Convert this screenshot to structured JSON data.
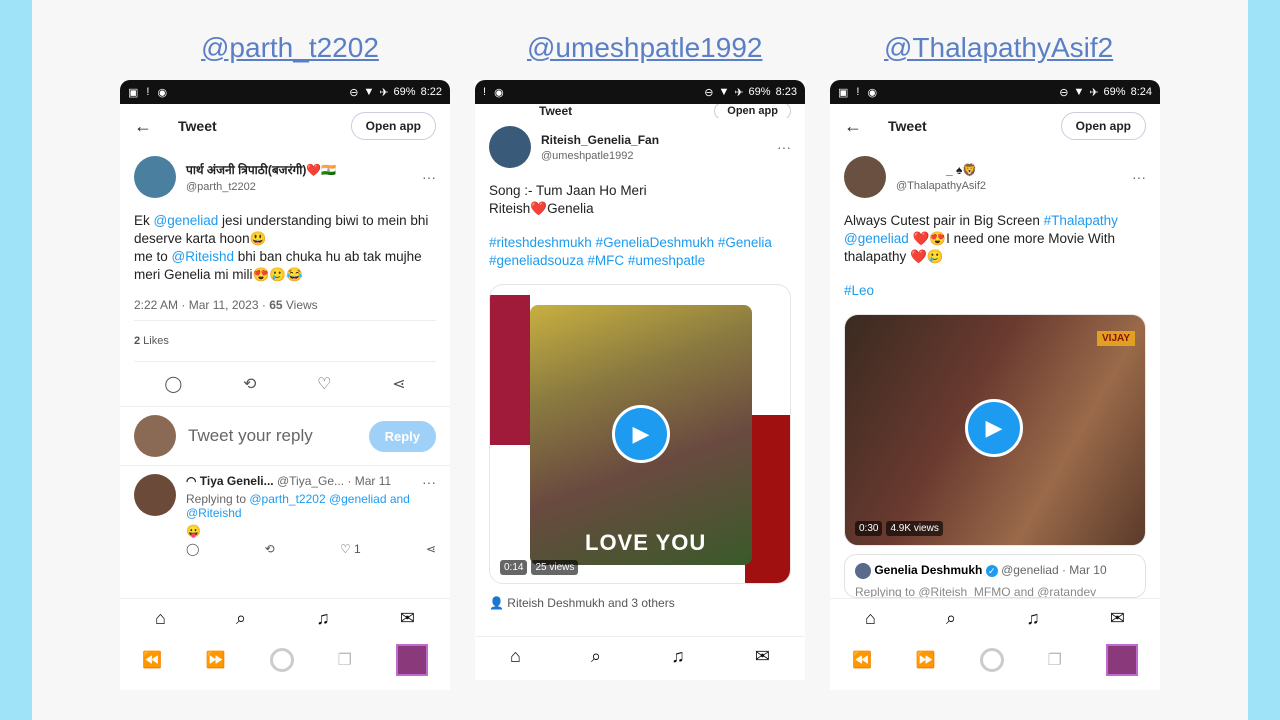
{
  "handles": [
    "@parth_t2202",
    "@umeshpatle1992",
    "@ThalapathyAsif2"
  ],
  "status": {
    "battery": "69%",
    "time1": "8:22",
    "time2": "8:23",
    "time3": "8:24"
  },
  "phone1": {
    "top_title": "Tweet",
    "open_app": "Open app",
    "display_name": "पार्थ अंजनी त्रिपाठी(बजरंगी)❤️🇮🇳",
    "username": "@parth_t2202",
    "text_a": "Ek ",
    "mention1": "@geneliad",
    "text_b": " jesi understanding biwi to mein bhi deserve karta hoon😃",
    "text_c": "me to  ",
    "mention2": "@Riteishd",
    "text_d": " bhi ban chuka hu ab tak mujhe meri Genelia mi mili😍🥲😂",
    "time": "2:22 AM · Mar 11, 2023 · ",
    "views_num": "65",
    "views_label": " Views",
    "likes_num": "2",
    "likes_label": " Likes",
    "reply_placeholder": "Tweet your reply",
    "reply_button": "Reply",
    "reply_name": "◠ Tiya Geneli...",
    "reply_user": "@Tiya_Ge...",
    "reply_date": "· Mar 11",
    "replying_to_label": "Replying to ",
    "replying_to": "@parth_t2202 @geneliad and @Riteishd",
    "reply_emoji": "😛",
    "reply_like_count": "1"
  },
  "phone2": {
    "top_title": "Tweet",
    "open_app": "Open app",
    "display_name": "Riteish_Genelia_Fan",
    "username": "@umeshpatle1992",
    "line1": "Song :- Tum Jaan Ho Meri",
    "line2": "Riteish❤️Genelia",
    "hashtags": "#riteshdeshmukh #GeneliaDeshmukh #Genelia #geneliadsouza #MFC #umeshpatle",
    "video_time": "0:14",
    "video_views": "25 views",
    "overlay_text": "LOVE YOU",
    "tagged": "Riteish Deshmukh and 3 others"
  },
  "phone3": {
    "top_title": "Tweet",
    "open_app": "Open app",
    "display_name": "_ ♠🦁",
    "username": "@ThalapathyAsif2",
    "text_a": "Always Cutest pair in Big Screen ",
    "tag1": "#Thalapathy",
    "mention": "@geneliad",
    "text_b": " ❤️😍I need one more Movie With thalapathy ❤️🥲",
    "tag2": "#Leo",
    "video_time": "0:30",
    "video_views": "4.9K views",
    "channel": "VIJAY",
    "quote_name": "Genelia Deshmukh",
    "quote_user": "@geneliad · Mar 10",
    "quote_text": "Replying to @Riteish_MFMO and @ratandev"
  }
}
